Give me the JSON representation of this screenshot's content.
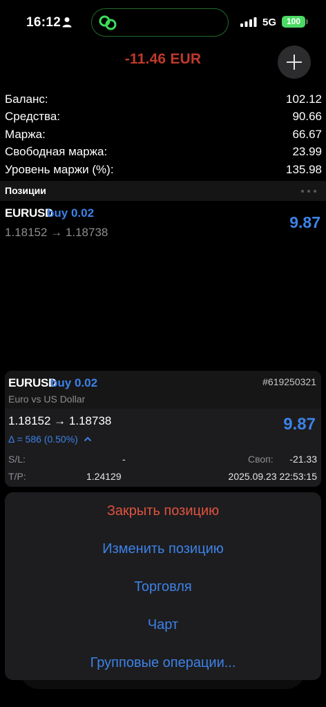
{
  "status_bar": {
    "time": "16:12",
    "network": "5G",
    "battery": "100",
    "battery_color": "#4cd964",
    "icons": [
      "person-icon",
      "link-icon",
      "signal-icon"
    ]
  },
  "header": {
    "total": "-11.46 EUR",
    "total_color": "#c0392b",
    "add_icon": "plus-icon"
  },
  "summary": [
    {
      "label": "Баланс:",
      "value": "102.12"
    },
    {
      "label": "Средства:",
      "value": "90.66"
    },
    {
      "label": "Маржа:",
      "value": "66.67"
    },
    {
      "label": "Свободная маржа:",
      "value": "23.99"
    },
    {
      "label": "Уровень маржи (%):",
      "value": "135.98"
    }
  ],
  "positions": {
    "title": "Позиции",
    "items": [
      {
        "symbol": "EURUSD",
        "side": "buy 0.02",
        "prices": "1.18152 → 1.18738",
        "profit": "9.87"
      }
    ]
  },
  "detail": {
    "symbol": "EURUSD",
    "side": "buy 0.02",
    "ticket": "#619250321",
    "description": "Euro vs US Dollar",
    "prices": "1.18152 → 1.18738",
    "delta": "Δ = 586 (0.50%)",
    "profit": "9.87",
    "sl_label": "S/L:",
    "sl_value": "-",
    "swap_label": "Своп:",
    "swap_value": "-21.33",
    "tp_label": "T/P:",
    "tp_value": "1.24129",
    "open_time": "2025.09.23 22:53:15"
  },
  "actions": {
    "close": "Закрыть позицию",
    "modify": "Изменить позицию",
    "trade": "Торговля",
    "chart": "Чарт",
    "bulk": "Групповые операции..."
  },
  "colors": {
    "accent": "#3d82e8",
    "loss": "#c0392b",
    "destructive": "#e0533f"
  }
}
